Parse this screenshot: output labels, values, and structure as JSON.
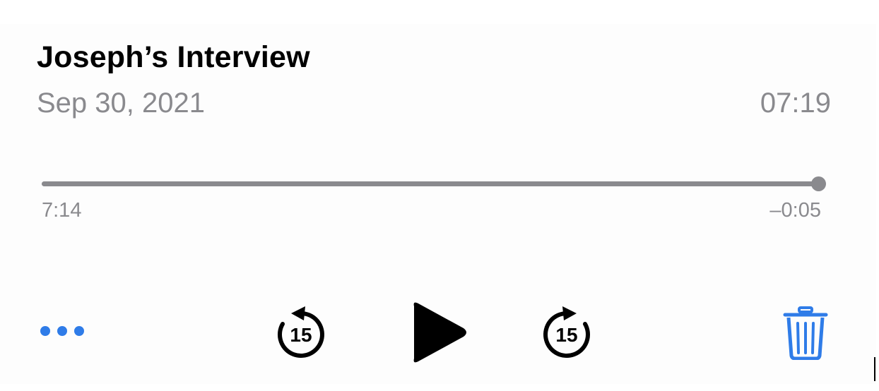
{
  "recording": {
    "title": "Joseph’s Interview",
    "date": "Sep 30, 2021",
    "duration": "07:19"
  },
  "scrubber": {
    "progress_percent": 99,
    "elapsed": "7:14",
    "remaining": "–0:05"
  },
  "controls": {
    "more_icon": "ellipsis-icon",
    "skip_back_icon": "skip-back-15-icon",
    "skip_back_seconds": "15",
    "play_icon": "play-icon",
    "skip_forward_icon": "skip-forward-15-icon",
    "skip_forward_seconds": "15",
    "delete_icon": "trash-icon"
  },
  "colors": {
    "accent": "#2f7ce8",
    "secondary_text": "#8a8a8e",
    "primary_text": "#000000"
  }
}
